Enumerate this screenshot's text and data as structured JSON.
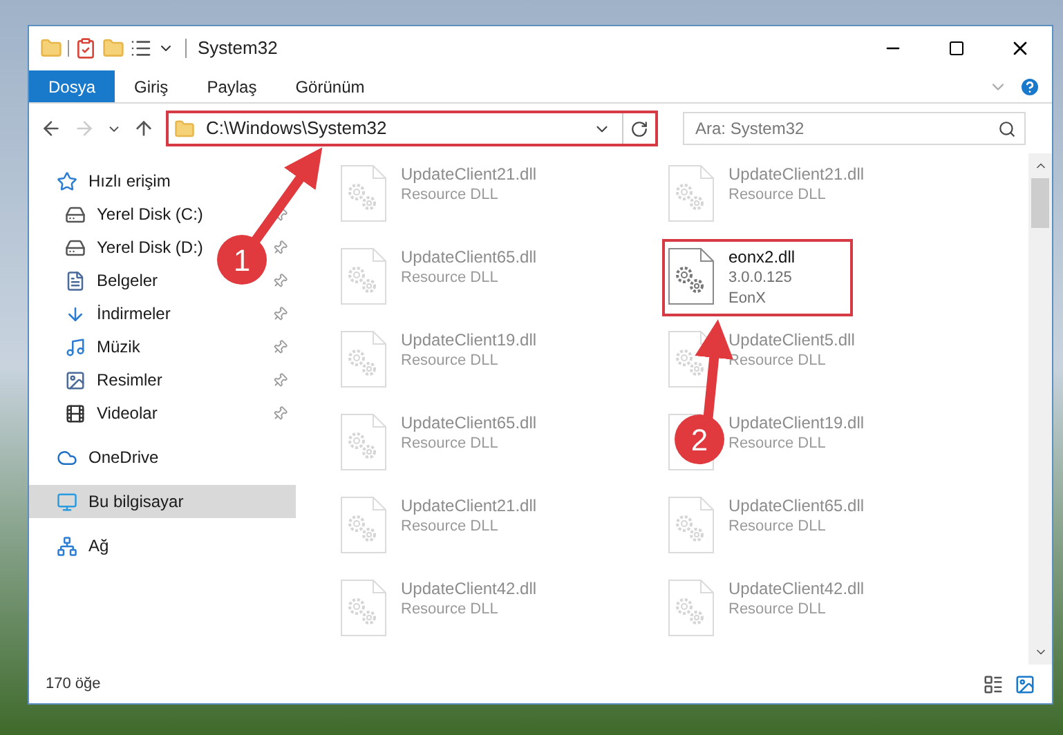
{
  "window": {
    "title": "System32"
  },
  "ribbon_tabs": [
    {
      "label": "Dosya",
      "selected": true
    },
    {
      "label": "Giriş",
      "selected": false
    },
    {
      "label": "Paylaş",
      "selected": false
    },
    {
      "label": "Görünüm",
      "selected": false
    }
  ],
  "address_bar": {
    "value": "C:\\Windows\\System32",
    "highlighted": true
  },
  "search": {
    "placeholder": "Ara: System32"
  },
  "sidebar": {
    "items": [
      {
        "label": "Hızlı erişim",
        "kind": "quick",
        "selected": false,
        "children": [
          {
            "label": "Yerel Disk (C:)",
            "kind": "disk-c",
            "pinned": true,
            "selected": false
          },
          {
            "label": "Yerel Disk (D:)",
            "kind": "disk",
            "pinned": true,
            "selected": false
          },
          {
            "label": "Belgeler",
            "kind": "docs",
            "pinned": true,
            "selected": false
          },
          {
            "label": "İndirmeler",
            "kind": "downloads",
            "pinned": true,
            "selected": false
          },
          {
            "label": "Müzik",
            "kind": "music",
            "pinned": true,
            "selected": false
          },
          {
            "label": "Resimler",
            "kind": "pictures",
            "pinned": true,
            "selected": false
          },
          {
            "label": "Videolar",
            "kind": "videos",
            "pinned": true,
            "selected": false
          }
        ]
      },
      {
        "label": "OneDrive",
        "kind": "cloud",
        "selected": false
      },
      {
        "label": "Bu bilgisayar",
        "kind": "pc",
        "selected": true
      },
      {
        "label": "Ağ",
        "kind": "network",
        "selected": false
      }
    ]
  },
  "files": [
    {
      "name": "UpdateClient21.dll",
      "details": [
        "Resource DLL"
      ],
      "faded": true,
      "highlighted": false
    },
    {
      "name": "UpdateClient21.dll",
      "details": [
        "Resource DLL"
      ],
      "faded": true,
      "highlighted": false
    },
    {
      "name": "UpdateClient65.dll",
      "details": [
        "Resource DLL"
      ],
      "faded": true,
      "highlighted": false
    },
    {
      "name": "eonx2.dll",
      "details": [
        "3.0.0.125",
        "EonX"
      ],
      "faded": false,
      "highlighted": true
    },
    {
      "name": "UpdateClient19.dll",
      "details": [
        "Resource DLL"
      ],
      "faded": true,
      "highlighted": false
    },
    {
      "name": "UpdateClient5.dll",
      "details": [
        "Resource DLL"
      ],
      "faded": true,
      "highlighted": false
    },
    {
      "name": "UpdateClient65.dll",
      "details": [
        "Resource DLL"
      ],
      "faded": true,
      "highlighted": false
    },
    {
      "name": "UpdateClient19.dll",
      "details": [
        "Resource DLL"
      ],
      "faded": true,
      "highlighted": false
    },
    {
      "name": "UpdateClient21.dll",
      "details": [
        "Resource DLL"
      ],
      "faded": true,
      "highlighted": false
    },
    {
      "name": "UpdateClient65.dll",
      "details": [
        "Resource DLL"
      ],
      "faded": true,
      "highlighted": false
    },
    {
      "name": "UpdateClient42.dll",
      "details": [
        "Resource DLL"
      ],
      "faded": true,
      "highlighted": false
    },
    {
      "name": "UpdateClient42.dll",
      "details": [
        "Resource DLL"
      ],
      "faded": true,
      "highlighted": false
    }
  ],
  "status_bar": {
    "count": "170 öğe"
  },
  "annotations": [
    {
      "label": "1"
    },
    {
      "label": "2"
    }
  ]
}
